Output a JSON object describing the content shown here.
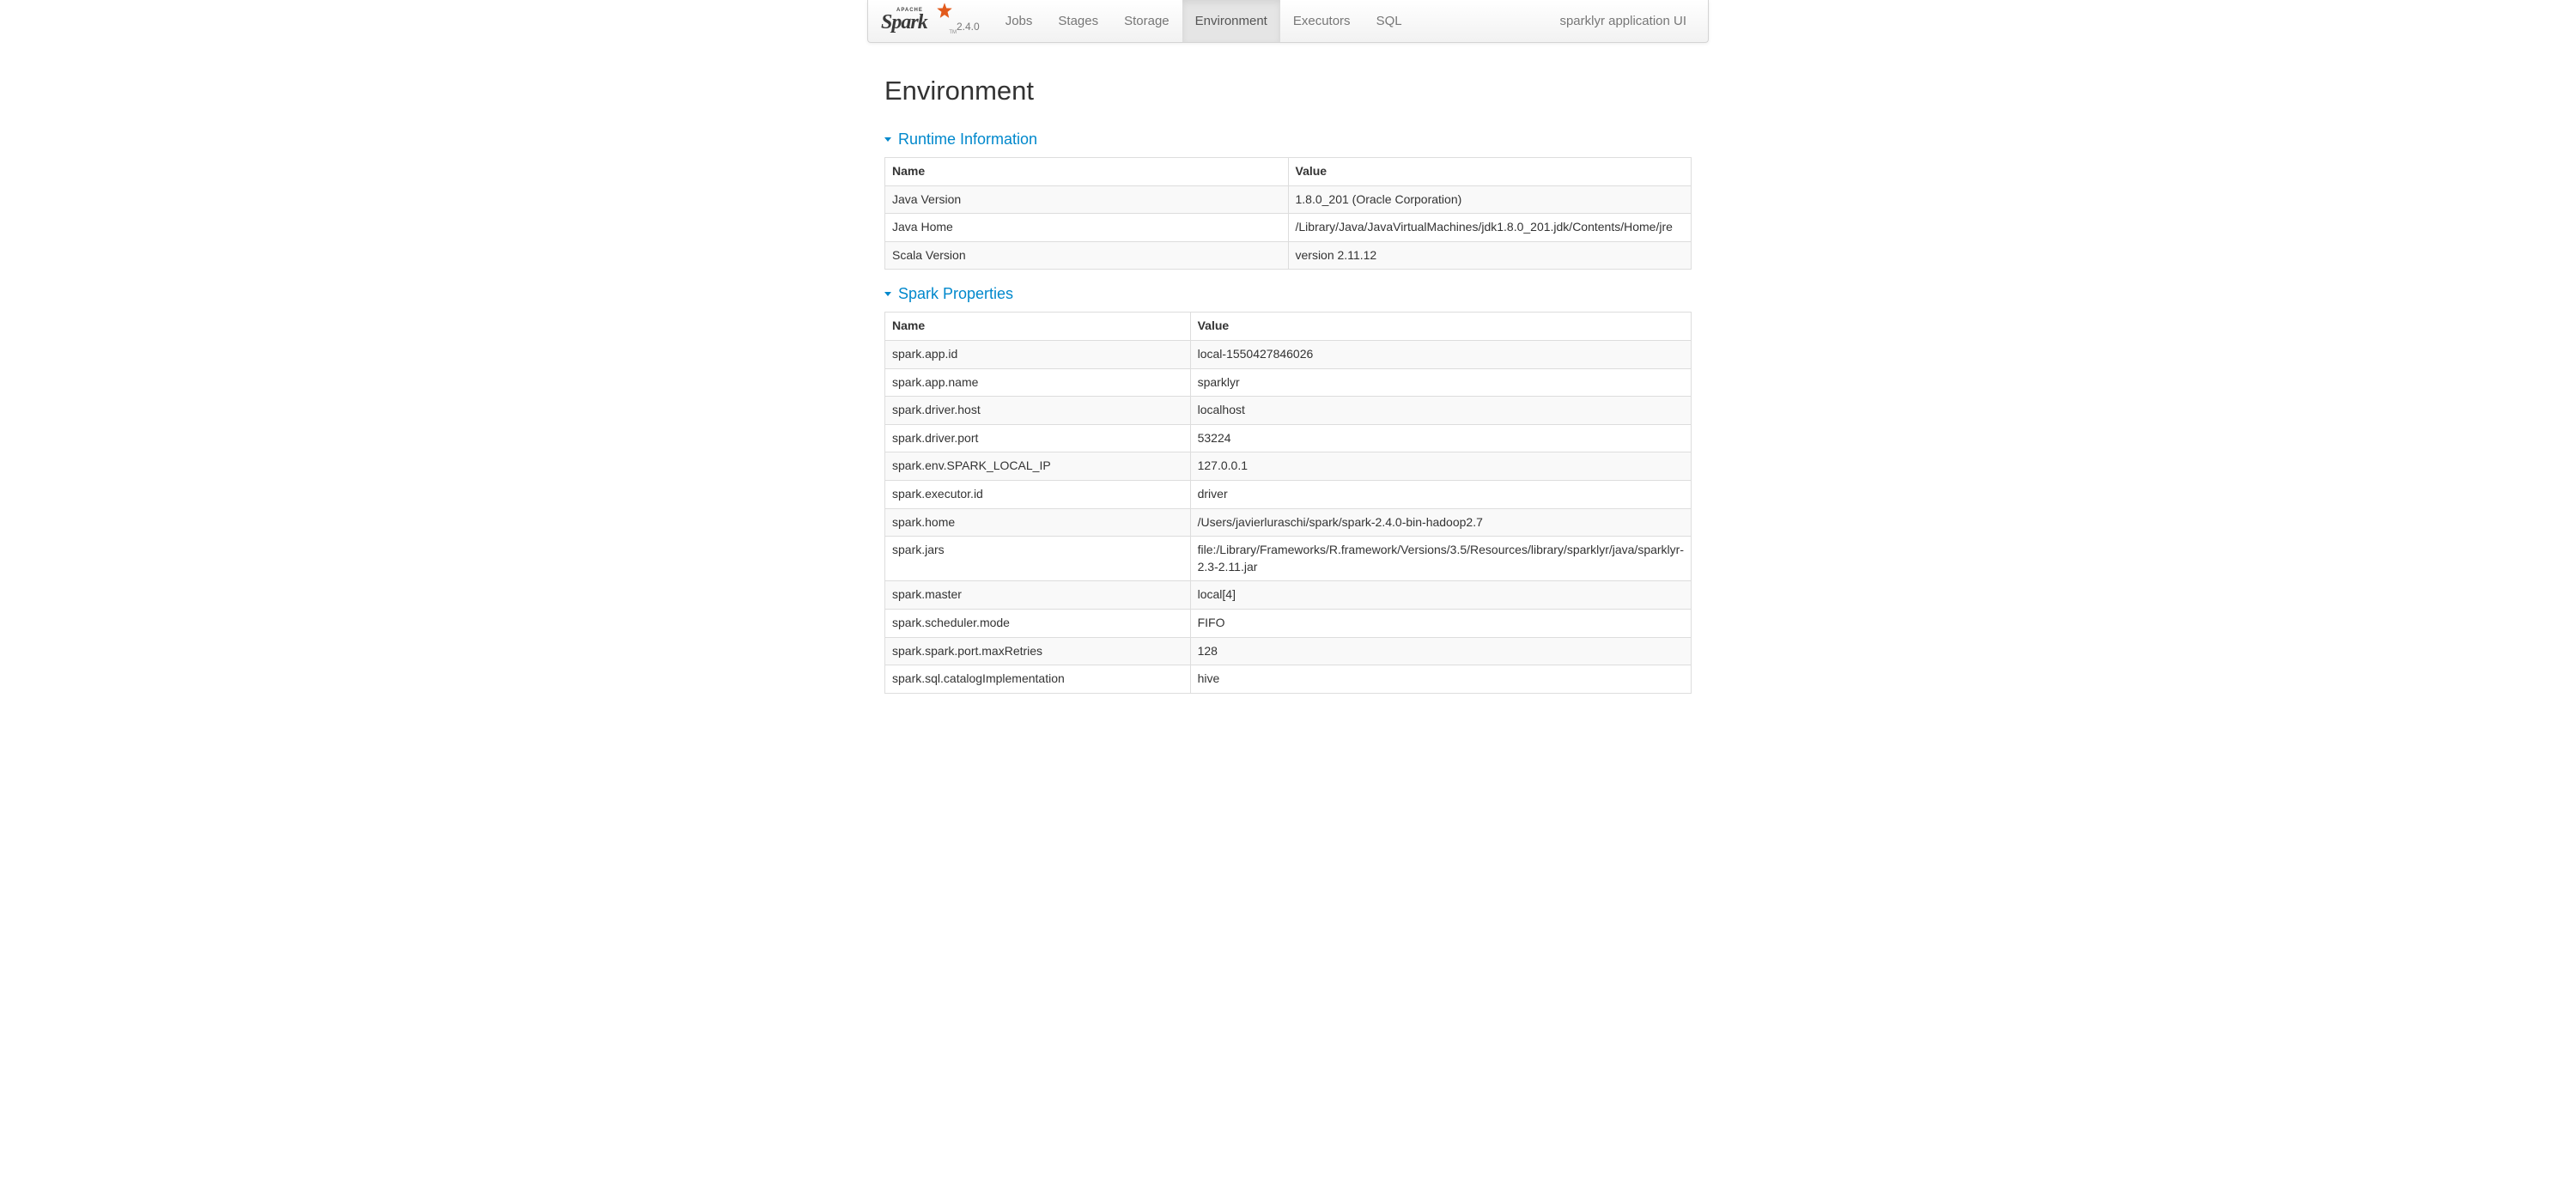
{
  "brand": {
    "apache": "APACHE",
    "name": "Spark",
    "tm": "TM",
    "version": "2.4.0"
  },
  "nav": {
    "items": [
      {
        "label": "Jobs",
        "active": false
      },
      {
        "label": "Stages",
        "active": false
      },
      {
        "label": "Storage",
        "active": false
      },
      {
        "label": "Environment",
        "active": true
      },
      {
        "label": "Executors",
        "active": false
      },
      {
        "label": "SQL",
        "active": false
      }
    ],
    "right_label": "sparklyr application UI"
  },
  "page": {
    "title": "Environment"
  },
  "sections": {
    "runtime": {
      "title": "Runtime Information",
      "headers": {
        "name": "Name",
        "value": "Value"
      },
      "rows": [
        {
          "name": "Java Version",
          "value": "1.8.0_201 (Oracle Corporation)"
        },
        {
          "name": "Java Home",
          "value": "/Library/Java/JavaVirtualMachines/jdk1.8.0_201.jdk/Contents/Home/jre"
        },
        {
          "name": "Scala Version",
          "value": "version 2.11.12"
        }
      ]
    },
    "spark_properties": {
      "title": "Spark Properties",
      "headers": {
        "name": "Name",
        "value": "Value"
      },
      "rows": [
        {
          "name": "spark.app.id",
          "value": "local-1550427846026"
        },
        {
          "name": "spark.app.name",
          "value": "sparklyr"
        },
        {
          "name": "spark.driver.host",
          "value": "localhost"
        },
        {
          "name": "spark.driver.port",
          "value": "53224"
        },
        {
          "name": "spark.env.SPARK_LOCAL_IP",
          "value": "127.0.0.1"
        },
        {
          "name": "spark.executor.id",
          "value": "driver"
        },
        {
          "name": "spark.home",
          "value": "/Users/javierluraschi/spark/spark-2.4.0-bin-hadoop2.7"
        },
        {
          "name": "spark.jars",
          "value": "file:/Library/Frameworks/R.framework/Versions/3.5/Resources/library/sparklyr/java/sparklyr-2.3-2.11.jar"
        },
        {
          "name": "spark.master",
          "value": "local[4]"
        },
        {
          "name": "spark.scheduler.mode",
          "value": "FIFO"
        },
        {
          "name": "spark.spark.port.maxRetries",
          "value": "128"
        },
        {
          "name": "spark.sql.catalogImplementation",
          "value": "hive"
        }
      ]
    }
  }
}
